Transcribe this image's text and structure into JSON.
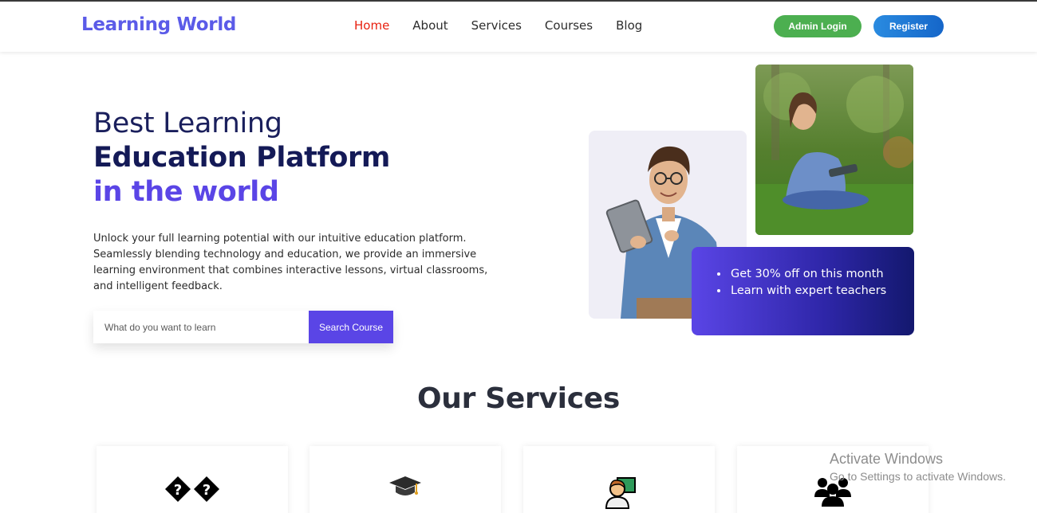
{
  "brand": {
    "logo": "Learning World",
    "accent": "#5a45e6"
  },
  "nav": {
    "items": [
      {
        "label": "Home",
        "active": true
      },
      {
        "label": "About",
        "active": false
      },
      {
        "label": "Services",
        "active": false
      },
      {
        "label": "Courses",
        "active": false
      },
      {
        "label": "Blog",
        "active": false
      }
    ],
    "admin_login": "Admin Login",
    "register": "Register"
  },
  "hero": {
    "line1": "Best Learning",
    "line2": "Education Platform",
    "line3": "in the world",
    "description": "Unlock your full learning potential with our intuitive education platform. Seamlessly blending technology and education, we provide an immersive learning environment that combines interactive lessons, virtual classrooms, and intelligent feedback.",
    "search_placeholder": "What do you want to learn",
    "search_button": "Search Course"
  },
  "promo": {
    "items": [
      "Get 30% off on this month",
      "Learn with expert teachers"
    ]
  },
  "services": {
    "title": "Our Services",
    "cards": [
      {
        "icon": "unknown-glyph-icon"
      },
      {
        "icon": "graduation-cap-icon"
      },
      {
        "icon": "teacher-icon"
      },
      {
        "icon": "group-people-icon"
      }
    ]
  },
  "windows_watermark": {
    "line1": "Activate Windows",
    "line2": "Go to Settings to activate Windows."
  }
}
